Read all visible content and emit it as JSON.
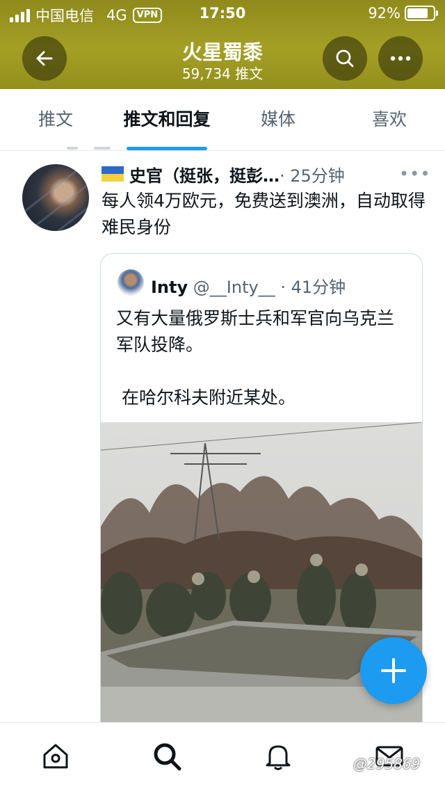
{
  "status_bar": {
    "carrier": "中国电信",
    "network": "4G",
    "vpn": "VPN",
    "time": "17:50",
    "battery": "92%",
    "battery_level": 0.92
  },
  "header": {
    "title": "火星蜀黍",
    "subtitle": "59,734 推文",
    "back_icon": "arrow-left-icon",
    "search_icon": "search-icon",
    "more_icon": "more-horizontal-icon",
    "bg_color": "#a09b23"
  },
  "tabs": [
    {
      "label": "推文",
      "active": false
    },
    {
      "label": "推文和回复",
      "active": true
    },
    {
      "label": "媒体",
      "active": false
    },
    {
      "label": "喜欢",
      "active": false
    }
  ],
  "tweet": {
    "author": "史官（挺张，挺彭…",
    "time": "· 25分钟",
    "more": "•••",
    "text": "每人领4万欧元，免费送到澳洲，自动取得难民身份",
    "quote": {
      "name": "Inty",
      "handle": "@__Inty__",
      "time": "· 41分钟",
      "text_line1": "又有大量俄罗斯士兵和军官向乌克兰军队投降。",
      "text_line2": " 在哈尔科夫附近某处。"
    }
  },
  "fab": {
    "icon": "plus-icon",
    "color": "#1d9bf0"
  },
  "bottom_nav": [
    {
      "icon": "home-icon"
    },
    {
      "icon": "search-icon"
    },
    {
      "icon": "notifications-bell-icon"
    },
    {
      "icon": "messages-mail-icon"
    }
  ],
  "watermark": "@295869",
  "accent_color": "#1d9bf0"
}
